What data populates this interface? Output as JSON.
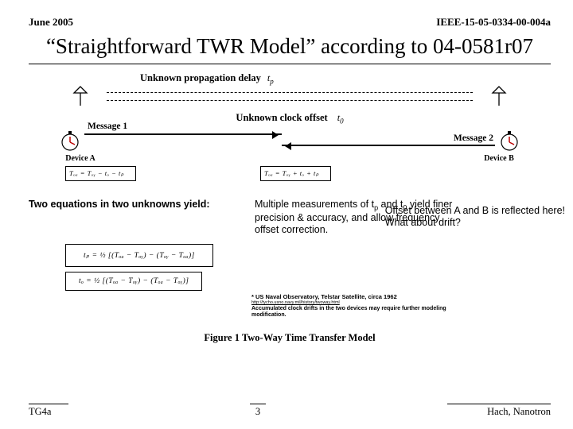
{
  "header": {
    "date": "June 2005",
    "docnum": "IEEE-15-05-0334-00-004a"
  },
  "title": "“Straightforward TWR Model” according to 04-0581r07",
  "model": {
    "unknown_prop_delay": "Unknown propagation delay",
    "t_p": "t",
    "t_p_sub": "p",
    "unknown_clock_offset": "Unknown clock offset",
    "t_0": "t",
    "t_0_sub": "0",
    "message1": "Message 1",
    "message2": "Message 2",
    "device_a": "Device A",
    "device_b": "Device B"
  },
  "eq_top_left": "Tₒₐ = Tₒᵧ − tₒ − tₚ",
  "eq_top_right": "Tₒₐ = Tₒᵧ + tₒ + tₚ",
  "offset_note_line1": "Offset between A and B is reflected here!",
  "offset_note_line2": "What about drift?",
  "left_block": "Two equations in two unknowns yield:",
  "right_block_html": "Multiple measurements of t",
  "right_block_tp_sub": "p",
  "right_block_mid": " and t",
  "right_block_t0_sub": "0",
  "right_block_tail": " yield finer precision & accuracy, and allow frequency offset correction.",
  "eq_big1": "tₚ = ½ [(Tₒₐ − Tₒᵧ) − (Tₒᵧ − Tₒₐ)]",
  "eq_big2": "tₒ = ½ [(Tₒₐ − Tₒᵧ) − (Tₒₐ − Tₒᵧ)]",
  "footnote": {
    "line1": "* US Naval Observatory, Telstar Satellite, circa 1962",
    "link": "http://tycho.usno.navy.mil/history/twoway.html",
    "line2": "Accumulated clock drifts in the two devices may require further modeling",
    "line3": "modification."
  },
  "figure_caption": "Figure 1 Two-Way Time Transfer Model",
  "footer": {
    "left": "TG4a",
    "page": "3",
    "right": "Hach, Nanotron"
  }
}
